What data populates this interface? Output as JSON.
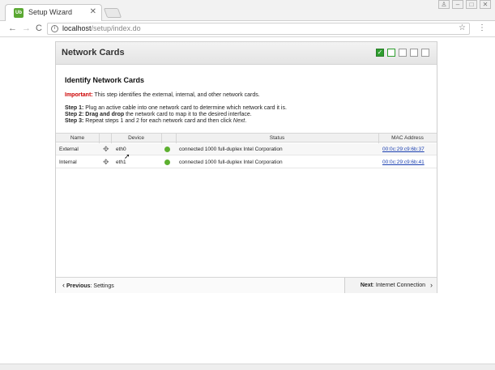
{
  "browser": {
    "tab_title": "Setup Wizard",
    "tab_close": "✕",
    "favicon_text": "Ub",
    "url_host": "localhost",
    "url_path": "/setup/index.do",
    "back": "←",
    "forward": "→",
    "reload": "C",
    "star": "☆",
    "menu": "⋮",
    "window_buttons": [
      "♙",
      "–",
      "□",
      "✕"
    ]
  },
  "wizard": {
    "title": "Network Cards",
    "steps": [
      {
        "state": "done"
      },
      {
        "state": "current"
      },
      {
        "state": "todo"
      },
      {
        "state": "todo"
      },
      {
        "state": "todo"
      }
    ],
    "heading": "Identify Network Cards",
    "important_label": "Important:",
    "important_text": " This step identifies the external, internal, and other network cards.",
    "step1_label": "Step 1:",
    "step1_text": " Plug an active cable into one network card to determine which network card it is.",
    "step2_label": "Step 2:",
    "step2_bold": " Drag and drop",
    "step2_text": " the network card to map it to the desired interface.",
    "step3_label": "Step 3:",
    "step3_text": " Repeat steps 1 and 2 for each network card and then click ",
    "step3_next": "Next",
    "step3_end": ".",
    "table": {
      "columns": [
        "Name",
        "Device",
        "Status",
        "MAC Address"
      ],
      "rows": [
        {
          "name": "External",
          "device": "eth0",
          "status": "connected 1000 full-duplex Intel Corporation",
          "mac": "00:0c:29:c9:6b:37"
        },
        {
          "name": "Internal",
          "device": "eth1",
          "status": "connected 1000 full-duplex Intel Corporation",
          "mac": "00:0c:29:c9:6b:41"
        }
      ]
    },
    "previous_label": "Previous",
    "previous_target": ": Settings",
    "next_label": "Next",
    "next_target": ": Internet Connection",
    "status_color": "#5db030",
    "accent_color": "#2e9e2e"
  }
}
